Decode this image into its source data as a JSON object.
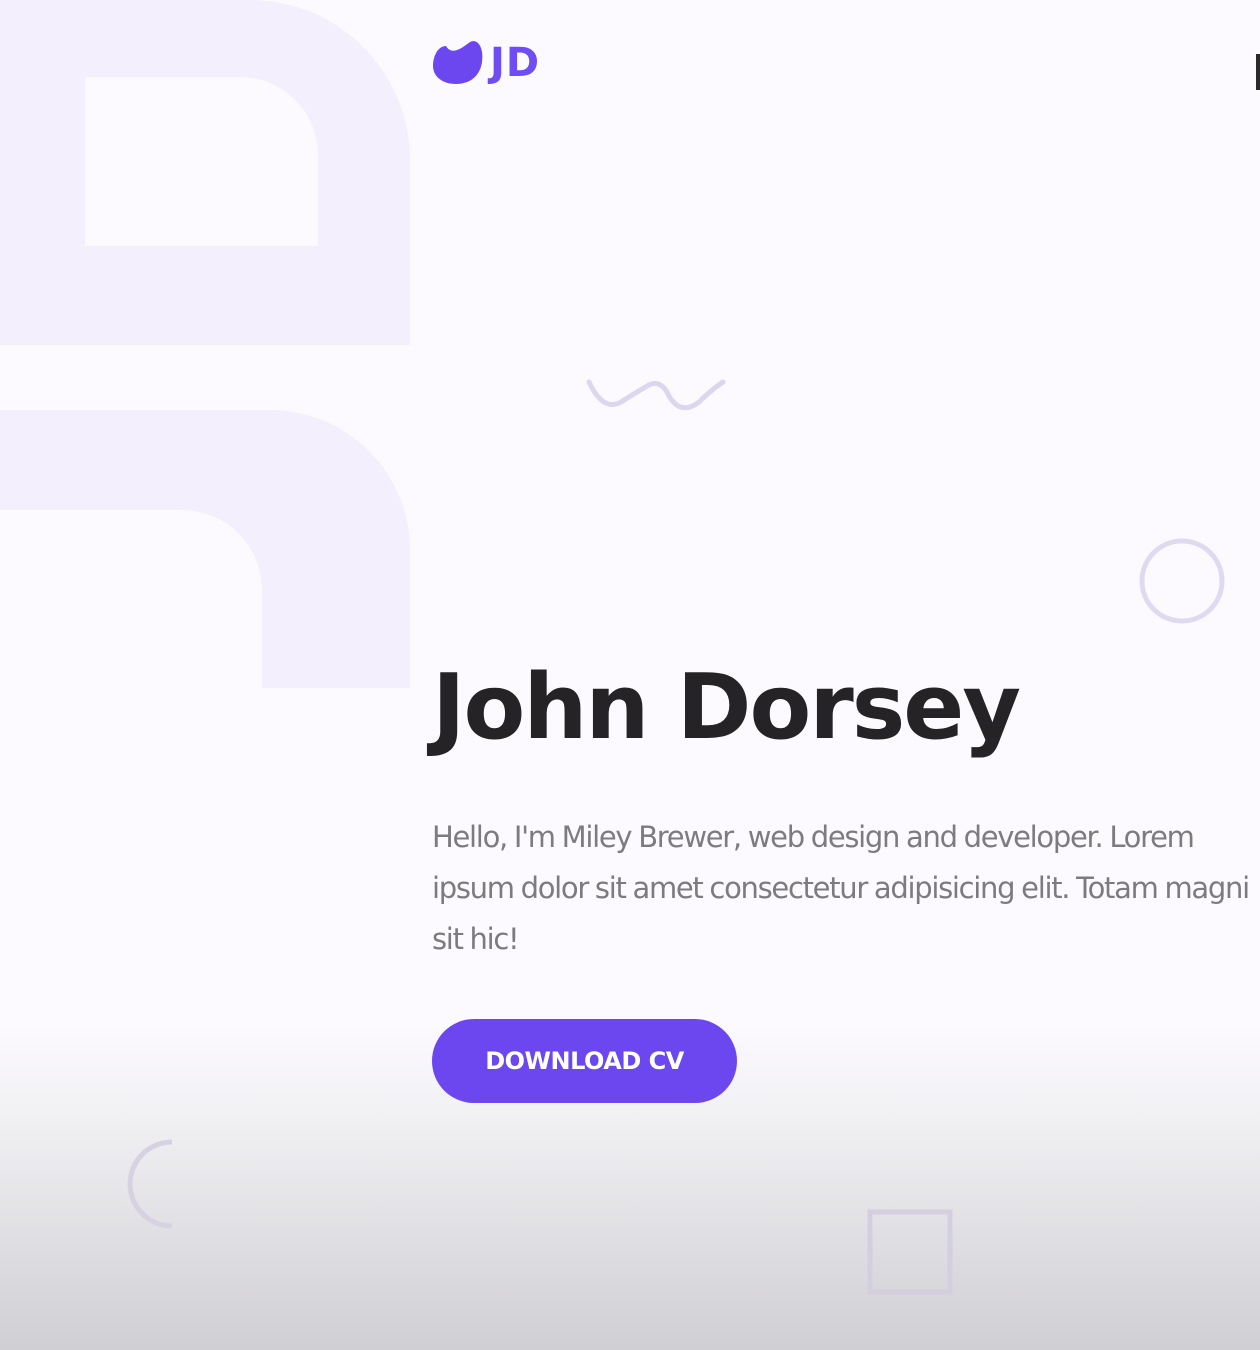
{
  "brand": {
    "logo_text": "JD",
    "monogram_text": "JD",
    "logo_icon": "blob-icon",
    "accent_color": "#6c47f0"
  },
  "hero": {
    "name": "John Dorsey",
    "description": "Hello, I'm Miley Brewer, web design and developer. Lorem ipsum dolor sit amet consectetur adipisicing elit. Totam magni sit hic!",
    "cta_label": "DOWNLOAD CV"
  },
  "decorations": [
    "wave-icon",
    "circle-icon",
    "arc-icon",
    "square-icon"
  ],
  "colors": {
    "background": "#fcfaff",
    "title": "#262327",
    "body_text": "#7d7a80",
    "monogram": "#f3effd",
    "decoration_stroke": "#dcd6ee"
  }
}
